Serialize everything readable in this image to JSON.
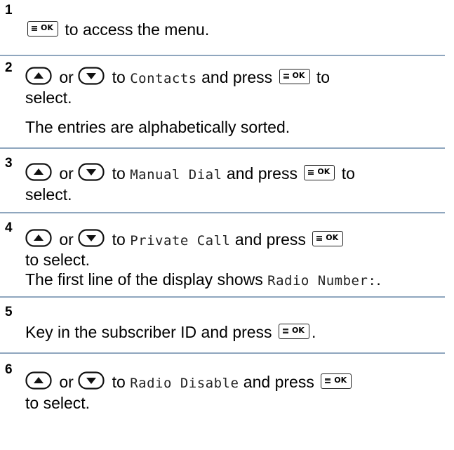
{
  "steps": [
    {
      "number": "1",
      "lines": [
        {
          "text_after_ok": " to access the menu."
        }
      ]
    },
    {
      "number": "2",
      "or": " or ",
      "to": " to ",
      "target": "Contacts",
      "and_press": " and press ",
      "to_select_tail": " to",
      "line2": "select.",
      "note": "The entries are alphabetically sorted."
    },
    {
      "number": "3",
      "or": " or ",
      "to": " to ",
      "target": "Manual Dial",
      "and_press": " and press ",
      "to_select_tail": " to",
      "line2": "select."
    },
    {
      "number": "4",
      "or": " or ",
      "to": " to ",
      "target": "Private Call",
      "and_press": " and press ",
      "line2": "to select.",
      "note_prefix": "The first line of the display shows ",
      "note_mono": "Radio Number:",
      "note_suffix": "."
    },
    {
      "number": "5",
      "text": "Key in the subscriber ID and press ",
      "text_suffix": "."
    },
    {
      "number": "6",
      "or": " or ",
      "to": " to ",
      "target": "Radio Disable",
      "and_press": " and press ",
      "line2": "to select."
    }
  ],
  "icons": {
    "ok_key_label": "OK",
    "up_key": "up-arrow-key",
    "down_key": "down-arrow-key",
    "menu_glyph": "menu-lines-icon"
  },
  "colors": {
    "divider": "#8fa6be",
    "text": "#000000"
  }
}
